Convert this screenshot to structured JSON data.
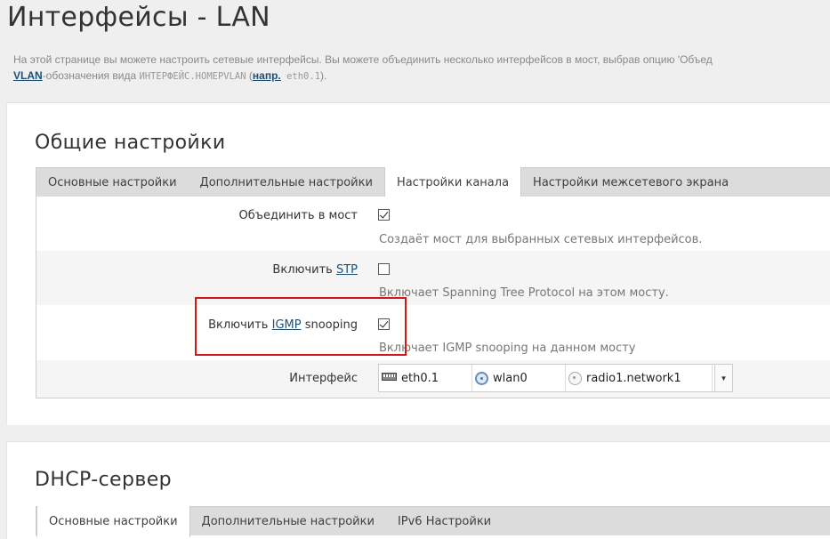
{
  "page": {
    "title": "Интерфейсы - LAN",
    "description": {
      "text_before": "На этой странице вы можете настроить сетевые интерфейсы. Вы можете объединить несколько интерфейсов в мост, выбрав опцию 'Объед",
      "vlan_link": "VLAN",
      "text_middle": "-обозначения вида ",
      "code_example": "ИНТЕРФЕЙС.НОМЕРVLAN",
      "paren_open": " (",
      "example_link": "напр.",
      "example_code": " eth0.1",
      "paren_close": ")."
    }
  },
  "general": {
    "title": "Общие настройки",
    "tabs": [
      {
        "label": "Основные настройки",
        "active": false
      },
      {
        "label": "Дополнительные настройки",
        "active": false
      },
      {
        "label": "Настройки канала",
        "active": true
      },
      {
        "label": "Настройки межсетевого экрана",
        "active": false
      }
    ],
    "bridge": {
      "label": "Объединить в мост",
      "checked": true,
      "help": "Создаёт мост для выбранных сетевых интерфейсов."
    },
    "stp": {
      "label_prefix": "Включить ",
      "label_link": "STP",
      "checked": false,
      "help": "Включает Spanning Tree Protocol на этом мосту."
    },
    "igmp": {
      "label_prefix": "Включить ",
      "label_link": "IGMP",
      "label_suffix": " snooping",
      "checked": true,
      "help": "Включает IGMP snooping на данном мосту"
    },
    "interface": {
      "label": "Интерфейс",
      "items": [
        {
          "icon": "ethernet-port-icon",
          "name": "eth0.1"
        },
        {
          "icon": "wireless-icon",
          "name": "wlan0"
        },
        {
          "icon": "wireless-disabled-icon",
          "name": "radio1.network1"
        }
      ],
      "dropdown_arrow": "▼"
    }
  },
  "dhcp": {
    "title": "DHCP-сервер",
    "tabs": [
      {
        "label": "Основные настройки",
        "active": true
      },
      {
        "label": "Дополнительные настройки",
        "active": false
      },
      {
        "label": "IPv6 Настройки",
        "active": false
      }
    ]
  },
  "colors": {
    "link": "#1c4f75",
    "highlight_border": "#d01919",
    "background": "#efefef"
  }
}
